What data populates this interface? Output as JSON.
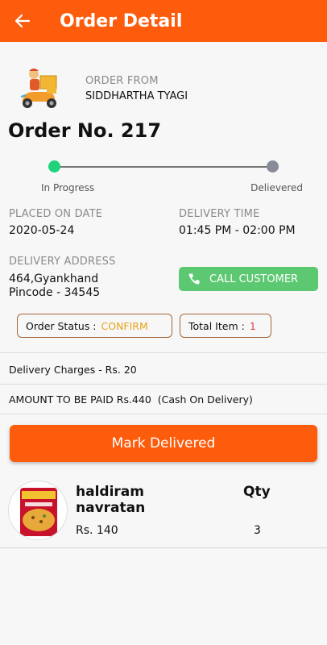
{
  "appbar": {
    "title": "Order Detail",
    "back_icon": "arrow-left-icon"
  },
  "order_from": {
    "label": "ORDER FROM",
    "name": "SIDDHARTHA TYAGI"
  },
  "order": {
    "number_text": "Order No. 217"
  },
  "tracker": {
    "start_label": "In Progress",
    "end_label": "Delievered",
    "active_color": "#20d37a",
    "inactive_color": "#888c99"
  },
  "placed": {
    "label": "PLACED ON DATE",
    "value": "2020-05-24"
  },
  "delivery_time": {
    "label": "DELIVERY TIME",
    "value": "01:45 PM - 02:00 PM"
  },
  "address": {
    "label": "DELIVERY ADDRESS",
    "line1": "464,Gyankhand",
    "line2": "Pincode - 34545"
  },
  "call_button": {
    "label": "CALL CUSTOMER",
    "icon": "phone-icon",
    "color": "#5cc972"
  },
  "status": {
    "label": "Order Status :",
    "value": "CONFIRM"
  },
  "total_items": {
    "label": "Total Item :",
    "value": "1"
  },
  "charges": {
    "text": "Delivery Charges - Rs. 20"
  },
  "amount": {
    "text": "AMOUNT TO BE PAID Rs.440  (Cash On Delivery)"
  },
  "primary_button": {
    "label": "Mark Delivered",
    "color": "#fc5c0c"
  },
  "items": [
    {
      "name": "haldiram navratan",
      "price": "Rs. 140",
      "qty_header": "Qty",
      "qty": "3"
    }
  ]
}
